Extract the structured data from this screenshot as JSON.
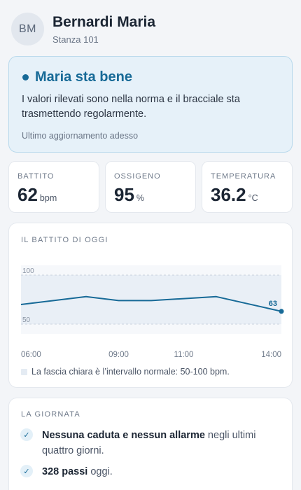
{
  "header": {
    "avatar_initials": "BM",
    "patient_name": "Bernardi Maria",
    "room": "Stanza 101"
  },
  "status": {
    "title": "Maria sta bene",
    "description": "I valori rilevati sono nella norma e il bracciale sta trasmettendo regolarmente.",
    "last_update": "Ultimo aggiornamento adesso",
    "color": "#176a97",
    "background": "#e6f1f9"
  },
  "metrics": [
    {
      "label": "BATTITO",
      "value": "62",
      "unit": "bpm"
    },
    {
      "label": "OSSIGENO",
      "value": "95",
      "unit": "%"
    },
    {
      "label": "TEMPERATURA",
      "value": "36.2",
      "unit": "°C"
    }
  ],
  "chart": {
    "heading": "IL BATTITO DI OGGI",
    "legend": "La fascia chiara è l’intervallo normale: 50-100 bpm.",
    "line_color": "#176a97"
  },
  "chart_data": {
    "type": "line",
    "title": "IL BATTITO DI OGGI",
    "x": [
      "06:00",
      "07:00",
      "08:00",
      "09:00",
      "10:00",
      "11:00",
      "12:00",
      "14:00"
    ],
    "x_hours": [
      6,
      7,
      8,
      9,
      10,
      11,
      12,
      14
    ],
    "values": [
      70,
      74,
      78,
      74,
      74,
      76,
      78,
      63
    ],
    "x_ticks": [
      "06:00",
      "09:00",
      "11:00",
      "14:00"
    ],
    "y_ticks": [
      "100",
      "50"
    ],
    "ylim": [
      40,
      110
    ],
    "normal_range": [
      50,
      100
    ],
    "last_value_label": "63",
    "grid": false
  },
  "day": {
    "heading": "LA GIORNATA",
    "items": [
      {
        "bold": "Nessuna caduta e nessun allarme",
        "rest": " negli ultimi quattro giorni.",
        "icon": "check-icon"
      },
      {
        "bold": "328 passi",
        "rest": " oggi.",
        "icon": "check-icon"
      }
    ]
  }
}
